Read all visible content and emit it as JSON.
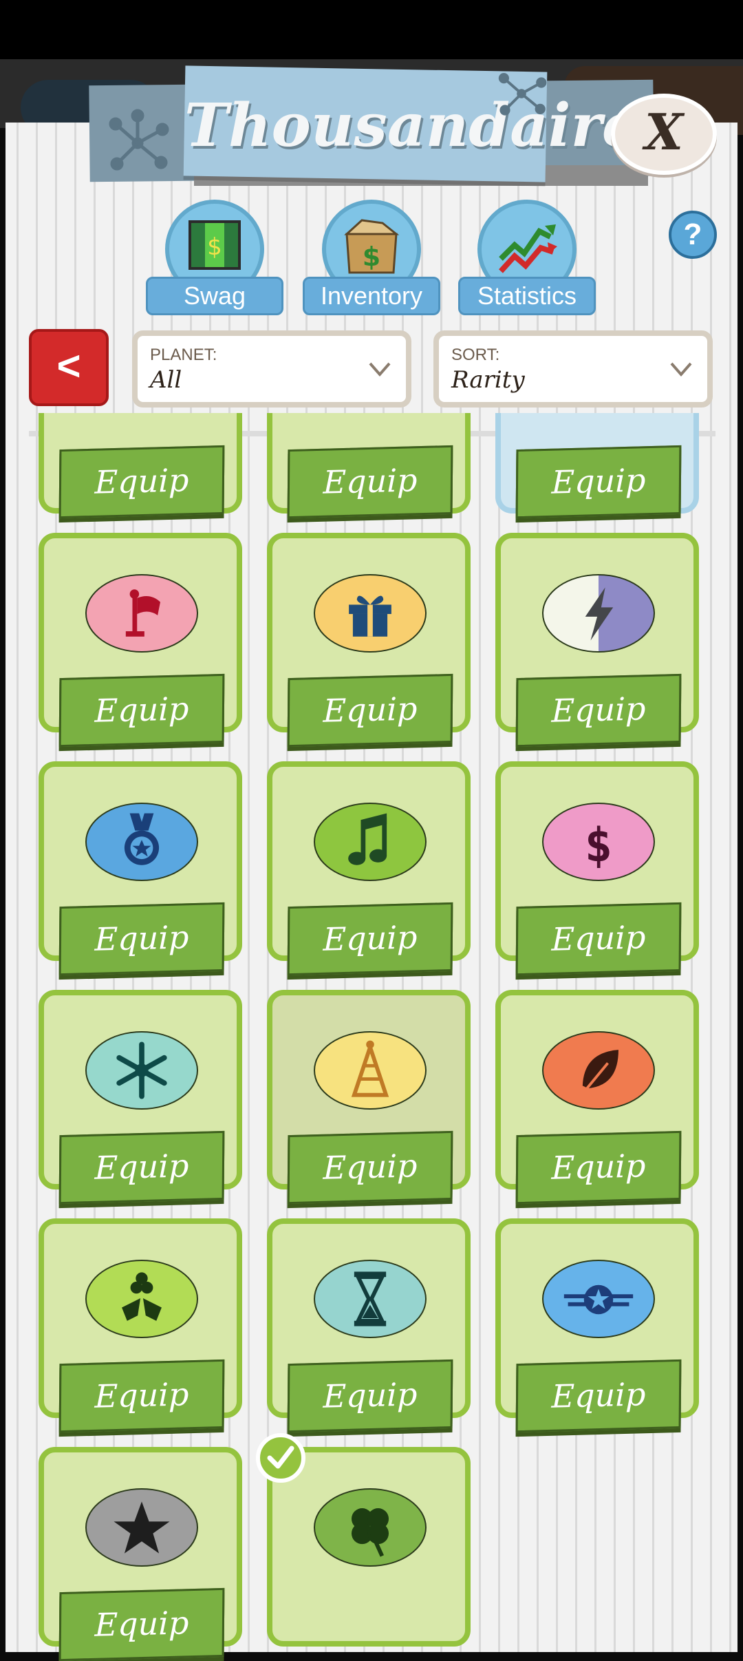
{
  "header": {
    "title": "Thousandaire!",
    "close_label": "X"
  },
  "tabs": [
    {
      "label": "Swag",
      "icon": "door-money-icon"
    },
    {
      "label": "Inventory",
      "icon": "box-money-icon"
    },
    {
      "label": "Statistics",
      "icon": "chart-arrows-icon"
    }
  ],
  "help_label": "?",
  "back_label": "<",
  "filters": {
    "planet": {
      "label": "PLANET:",
      "value": "All"
    },
    "sort": {
      "label": "SORT:",
      "value": "Rarity"
    }
  },
  "equip_label": "Equip",
  "items": [
    {
      "name": "flag",
      "bg": "#f3a3b2",
      "icon": "flag-icon"
    },
    {
      "name": "gift",
      "bg": "#f8cf6f",
      "icon": "gift-icon"
    },
    {
      "name": "lightning",
      "bg": "#8e8ac6",
      "icon": "lightning-icon"
    },
    {
      "name": "medal",
      "bg": "#5aa7e0",
      "icon": "medal-icon"
    },
    {
      "name": "music",
      "bg": "#8ec63f",
      "icon": "music-note-icon"
    },
    {
      "name": "money",
      "bg": "#ef9bc8",
      "icon": "dollar-icon"
    },
    {
      "name": "snowflake",
      "bg": "#96d8cc",
      "icon": "snowflake-icon"
    },
    {
      "name": "party-hat",
      "bg": "#f7e27f",
      "icon": "party-hat-icon"
    },
    {
      "name": "leaf",
      "bg": "#f07b4f",
      "icon": "leaf-icon"
    },
    {
      "name": "holly",
      "bg": "#b2dc55",
      "icon": "holly-icon"
    },
    {
      "name": "hourglass",
      "bg": "#96d4cf",
      "icon": "hourglass-icon"
    },
    {
      "name": "wings-star",
      "bg": "#66b3ea",
      "icon": "wings-star-icon"
    },
    {
      "name": "star",
      "bg": "#9e9e9e",
      "icon": "star-icon"
    },
    {
      "name": "clover",
      "bg": "#7fb449",
      "icon": "clover-icon"
    }
  ]
}
